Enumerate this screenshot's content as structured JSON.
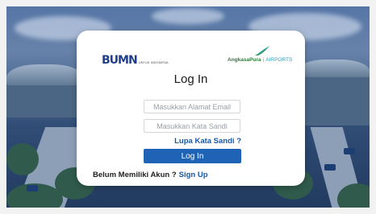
{
  "bumn_logo": {
    "mark": "BUMN",
    "tagline": "UNTUK INDONESIA"
  },
  "ap_logo": {
    "name": "AngkasaPura",
    "separator": "|",
    "division": "AIRPORTS"
  },
  "login": {
    "title": "Log In",
    "email_placeholder": "Masukkan Alamat Email",
    "password_placeholder": "Masukkan Kata Sandi",
    "forgot_label": "Lupa Kata Sandi ?",
    "submit_label": "Log In",
    "no_account_text": "Belum Memiliki Akun ?",
    "signup_label": "Sign Up"
  },
  "colors": {
    "primary": "#1e63b5",
    "link": "#1558a8",
    "brand_green": "#2f7a3c"
  }
}
